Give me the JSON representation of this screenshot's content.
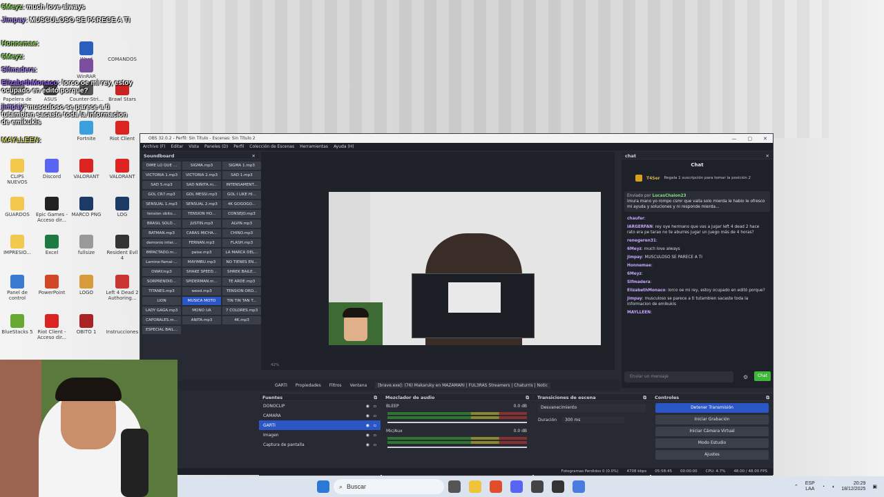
{
  "overlay_chat": [
    {
      "user": "6Meyz",
      "sep": ":",
      "text": "much love always"
    },
    {
      "user": "Jimpay",
      "sep": ":",
      "text": "MUSCULOSO SE PARECE A TI"
    },
    {
      "user": "Honnemae",
      "sep": ":",
      "text": ""
    },
    {
      "user": "6Meyz",
      "sep": ":",
      "text": ""
    },
    {
      "user": "Slfmadera",
      "sep": ":",
      "text": ""
    },
    {
      "user": "ElizabethMonaco",
      "sep": ":",
      "text": "lorco oe mi rey, estoy ocupado en editó porque?"
    },
    {
      "user": "jimpay",
      "sep": ":",
      "text": "musculoso se parece a ti tutambien sacaste toda la informacion de emikukis"
    },
    {
      "user": "MAYLLEEN",
      "sep": ":",
      "text": ""
    }
  ],
  "desktop_icons": [
    {
      "label": "Word",
      "color": "#2b5fbd"
    },
    {
      "label": "COMANDOS",
      "color": "#eeeeee"
    },
    {
      "label": "WinRAR",
      "color": "#7a4fa0"
    },
    {
      "label": "ASUS",
      "color": "#444444"
    },
    {
      "label": "Counter-Stri...",
      "color": "#555555"
    },
    {
      "label": "Brawl Stars",
      "color": "#c22"
    },
    {
      "label": "Papelera de reciclaje",
      "color": "#888888"
    },
    {
      "label": "Fortnite",
      "color": "#3aa0e0"
    },
    {
      "label": "Riot Client",
      "color": "#d22"
    },
    {
      "label": "CLIPS NUEVOS",
      "color": "#f2c94c"
    },
    {
      "label": "Discord",
      "color": "#5865f2"
    },
    {
      "label": "VALORANT",
      "color": "#d22"
    },
    {
      "label": "VALORANT",
      "color": "#d22"
    },
    {
      "label": "GUARDOS",
      "color": "#f2c94c"
    },
    {
      "label": "Epic Games - Acceso dir...",
      "color": "#222"
    },
    {
      "label": "MARCO PNG",
      "color": "#1c3a66"
    },
    {
      "label": "LOG",
      "color": "#1c3a66"
    },
    {
      "label": "IMPRESIO...",
      "color": "#f2c94c"
    },
    {
      "label": "Excel",
      "color": "#1e7a43"
    },
    {
      "label": "fullsize",
      "color": "#999"
    },
    {
      "label": "Resident Evil 4",
      "color": "#333"
    },
    {
      "label": "Panel de control",
      "color": "#3a7ad0"
    },
    {
      "label": "PowerPoint",
      "color": "#d24726"
    },
    {
      "label": "LOGO",
      "color": "#d89a3a"
    },
    {
      "label": "Left 4 Dead 2 Authoring...",
      "color": "#c33"
    },
    {
      "label": "BlueStacks 5",
      "color": "#6a3"
    },
    {
      "label": "Riot Client - Acceso dir...",
      "color": "#d22"
    },
    {
      "label": "OBITO 1",
      "color": "#a22"
    },
    {
      "label": "Instrucciones",
      "color": "#eee"
    }
  ],
  "obs": {
    "title": "OBS 32.0.2 - Perfil: Sin Título - Escenas: Sin Título 2",
    "menu": [
      "Archivo (F)",
      "Editar",
      "Vista",
      "Paneles (D)",
      "Perfil",
      "Colección de Escenas",
      "Herramientas",
      "Ayuda (H)"
    ],
    "soundboard_title": "Soundboard",
    "soundboard": [
      "DIME LO QUE ...",
      "SIGMA.mp3",
      "SIGMA 1.mp3",
      "VICTORIA 1.mp3",
      "VICTORIA 2.mp3",
      "SAD 1.mp3",
      "SAD 5.mp3",
      "SAD NIÑITA.m...",
      "INTENSAMENT...",
      "GOL CR7.mp3",
      "GOL MESSI.mp3",
      "GOL I LIKE HI...",
      "SENSUAL 1.mp3",
      "SENSUAL 2.mp3",
      "4K GOGOGO...",
      "tension obito...",
      "TENSION HO...",
      "CONSEJO.mp3",
      "BRASIL SOLD...",
      "JUSTIN.mp3",
      "ALVIN.mp3",
      "BATMAN.mp3",
      "CARAS MICHA...",
      "CHINO.mp3",
      "demonio inter...",
      "FERNAN.mp3",
      "FLASH.mp3",
      "IMPACTADO.m...",
      "paise.mp3",
      "LA MARCA DEL...",
      "Lamine-Yamal-...",
      "MAYIMBU.mp3",
      "NO TIENES EN...",
      "OWAY.mp3",
      "SHAKE SPEED...",
      "SHREK BAILE...",
      "SORPRENDID...",
      "SPIDERMAN.m...",
      "TE ARDE.mp3",
      "TITANES.mp3",
      "weed.mp3",
      "TENSION ORO...",
      "LION",
      "MUSICA MOTO",
      "TIN TIN TAN T...",
      "LADY GAGA.mp3",
      "MONO UA",
      "7 COLORES.mp3",
      "CAPORALES.m...",
      "ANITA.mp3",
      "4K.mp3",
      "ESPECIAL BAIL..."
    ],
    "active_sound": "MUSICA MOTO",
    "chat_dock_title": "chat",
    "chat_title": "Chat",
    "gift": {
      "user": "T4Ser",
      "text": "Regala 1 suscripción para tomar la posición 2"
    },
    "pinned": {
      "label": "Enviado por",
      "user": "LucasChaion23",
      "text": "imura mano yo rompo csmr que valla solo mierda le hablo le ofresco mi ayuda y soluciones y ni responde mierda..."
    },
    "messages": [
      {
        "user": "chaufer",
        "text": ""
      },
      {
        "user": "IARGERFAN",
        "text": "rey oye hermano que vas a jugar left 4 dead 2 hace rato era pe tarao no te aburres jugar un juego más de 4 horas?"
      },
      {
        "user": "renegeren31",
        "text": ""
      },
      {
        "user": "6Meyz",
        "text": "much love always"
      },
      {
        "user": "jimpay",
        "text": "MUSCULOSO SE PARECE A TI"
      },
      {
        "user": "Honnemae",
        "text": ""
      },
      {
        "user": "6Meyz",
        "text": ""
      },
      {
        "user": "Slfmadera",
        "text": ""
      },
      {
        "user": "ElizabethMonaco",
        "text": "lorco oe mi rey, estoy ocupado en editó porque?"
      },
      {
        "user": "jimpay",
        "text": "musculoso se parece a ti tutambien sacaste toda la informacion de emikukis"
      },
      {
        "user": "MAYLLEEN",
        "text": ""
      }
    ],
    "chat_placeholder": "Enviar un mensaje",
    "chat_send": "Chat",
    "source_bar": {
      "name": "GARTI",
      "props": "Propiedades",
      "filters": "Filtros",
      "window_label": "Ventana",
      "window_value": "[brave.exe]: (76) Makaruky en MAZAMARI | FUL3RAS Streamers | Chaturris | Notic"
    },
    "sources_title": "Fuentes",
    "sources": [
      "DONOCLIP",
      "CAMARA",
      "GARTI",
      "Imagen",
      "Captura de pantalla"
    ],
    "selected_source": "GARTI",
    "mixer_title": "Mezclador de audio",
    "mixer": [
      {
        "name": "BLEEP",
        "db": "0.0 dB"
      },
      {
        "name": "Mic/Aux",
        "db": "0.0 dB"
      }
    ],
    "transitions_title": "Transiciones de escena",
    "transition_value": "Desvanecimiento",
    "duration_label": "Duración",
    "duration_value": "300 ms",
    "controls_title": "Controles",
    "controls": [
      "Detener Transmisión",
      "Iniciar Grabación",
      "Iniciar Cámara Virtual",
      "Modo Estudio",
      "Ajustes"
    ],
    "status": {
      "dropped": "Fotogramas Perdidos 0 (0.0%)",
      "bitrate": "4708 kbps",
      "live_time": "05:58:45",
      "rec_time": "00:00:00",
      "cpu": "CPU: 4.7%",
      "fps": "48.00 / 48.00 FPS"
    },
    "zoom": "42%"
  },
  "taskbar": {
    "search_placeholder": "Buscar",
    "lang": "ESP",
    "lang2": "LAA",
    "time": "20:29",
    "date": "18/12/2025"
  }
}
